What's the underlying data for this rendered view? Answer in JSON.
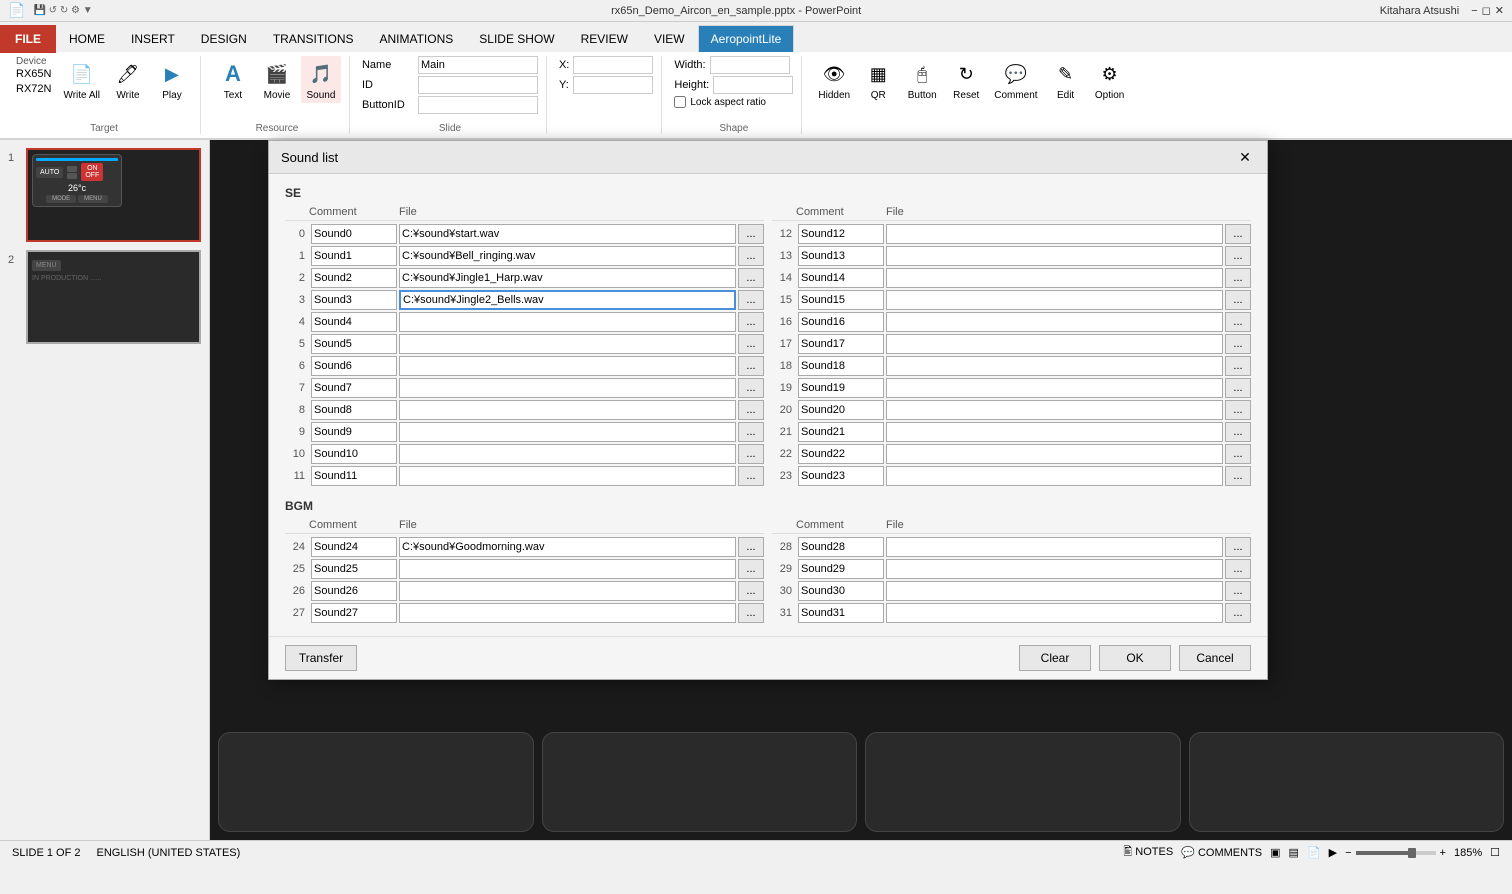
{
  "titleBar": {
    "title": "rx65n_Demo_Aircon_en_sample.pptx - PowerPoint",
    "user": "Kitahara Atsushi"
  },
  "ribbon": {
    "tabs": [
      "FILE",
      "HOME",
      "INSERT",
      "DESIGN",
      "TRANSITIONS",
      "ANIMATIONS",
      "SLIDE SHOW",
      "REVIEW",
      "VIEW",
      "AeropointLite"
    ],
    "activeTab": "AeropointLite",
    "groups": {
      "target": {
        "label": "Target",
        "device": "Device",
        "deviceValue": "RX65N\nRX72N",
        "buttons": [
          "Write All",
          "Write",
          "Play"
        ]
      },
      "resource": {
        "label": "Resource",
        "buttons": [
          "Text",
          "Movie",
          "Sound"
        ]
      },
      "slide": {
        "label": "Slide",
        "nameLabel": "Name",
        "nameValue": "Main",
        "idLabel": "ID",
        "idValue": "",
        "buttonIdLabel": "ButtonID",
        "buttonIdValue": ""
      },
      "xy": {
        "xLabel": "X:",
        "xValue": "",
        "yLabel": "Y:",
        "yValue": ""
      },
      "shape": {
        "label": "Shape",
        "widthLabel": "Width:",
        "widthValue": "",
        "heightLabel": "Height:",
        "heightValue": "",
        "lockLabel": "Lock aspect ratio"
      },
      "actions": {
        "buttons": [
          "Hidden",
          "QR",
          "Button",
          "Reset",
          "Comment",
          "Edit",
          "Option"
        ]
      }
    }
  },
  "slidePanel": {
    "slides": [
      {
        "num": "1",
        "label": "Slide 1"
      },
      {
        "num": "2",
        "label": "Slide 2"
      }
    ]
  },
  "statusBar": {
    "slideInfo": "SLIDE 1 OF 2",
    "language": "ENGLISH (UNITED STATES)",
    "notes": "NOTES",
    "comments": "COMMENTS",
    "zoom": "185%"
  },
  "dialog": {
    "title": "Sound list",
    "sections": {
      "se": {
        "label": "SE",
        "columnHeaders": {
          "comment": "Comment",
          "file": "File"
        },
        "leftSounds": [
          {
            "num": "0",
            "comment": "Sound0",
            "file": "C:¥sound¥start.wav",
            "active": false
          },
          {
            "num": "1",
            "comment": "Sound1",
            "file": "C:¥sound¥Bell_ringing.wav",
            "active": false
          },
          {
            "num": "2",
            "comment": "Sound2",
            "file": "C:¥sound¥Jingle1_Harp.wav",
            "active": false
          },
          {
            "num": "3",
            "comment": "Sound3",
            "file": "C:¥sound¥Jingle2_Bells.wav",
            "active": true
          },
          {
            "num": "4",
            "comment": "Sound4",
            "file": "",
            "active": false
          },
          {
            "num": "5",
            "comment": "Sound5",
            "file": "",
            "active": false
          },
          {
            "num": "6",
            "comment": "Sound6",
            "file": "",
            "active": false
          },
          {
            "num": "7",
            "comment": "Sound7",
            "file": "",
            "active": false
          },
          {
            "num": "8",
            "comment": "Sound8",
            "file": "",
            "active": false
          },
          {
            "num": "9",
            "comment": "Sound9",
            "file": "",
            "active": false
          },
          {
            "num": "10",
            "comment": "Sound10",
            "file": "",
            "active": false
          },
          {
            "num": "11",
            "comment": "Sound11",
            "file": "",
            "active": false
          }
        ],
        "rightSounds": [
          {
            "num": "12",
            "comment": "Sound12",
            "file": "",
            "active": false
          },
          {
            "num": "13",
            "comment": "Sound13",
            "file": "",
            "active": false
          },
          {
            "num": "14",
            "comment": "Sound14",
            "file": "",
            "active": false
          },
          {
            "num": "15",
            "comment": "Sound15",
            "file": "",
            "active": false
          },
          {
            "num": "16",
            "comment": "Sound16",
            "file": "",
            "active": false
          },
          {
            "num": "17",
            "comment": "Sound17",
            "file": "",
            "active": false
          },
          {
            "num": "18",
            "comment": "Sound18",
            "file": "",
            "active": false
          },
          {
            "num": "19",
            "comment": "Sound19",
            "file": "",
            "active": false
          },
          {
            "num": "20",
            "comment": "Sound20",
            "file": "",
            "active": false
          },
          {
            "num": "21",
            "comment": "Sound21",
            "file": "",
            "active": false
          },
          {
            "num": "22",
            "comment": "Sound22",
            "file": "",
            "active": false
          },
          {
            "num": "23",
            "comment": "Sound23",
            "file": "",
            "active": false
          }
        ]
      },
      "bgm": {
        "label": "BGM",
        "leftSounds": [
          {
            "num": "24",
            "comment": "Sound24",
            "file": "C:¥sound¥Goodmorning.wav",
            "active": false
          },
          {
            "num": "25",
            "comment": "Sound25",
            "file": "",
            "active": false
          },
          {
            "num": "26",
            "comment": "Sound26",
            "file": "",
            "active": false
          },
          {
            "num": "27",
            "comment": "Sound27",
            "file": "",
            "active": false
          }
        ],
        "rightSounds": [
          {
            "num": "28",
            "comment": "Sound28",
            "file": "",
            "active": false
          },
          {
            "num": "29",
            "comment": "Sound29",
            "file": "",
            "active": false
          },
          {
            "num": "30",
            "comment": "Sound30",
            "file": "",
            "active": false
          },
          {
            "num": "31",
            "comment": "Sound31",
            "file": "",
            "active": false
          }
        ]
      }
    },
    "buttons": {
      "transfer": "Transfer",
      "clear": "Clear",
      "ok": "OK",
      "cancel": "Cancel"
    }
  }
}
